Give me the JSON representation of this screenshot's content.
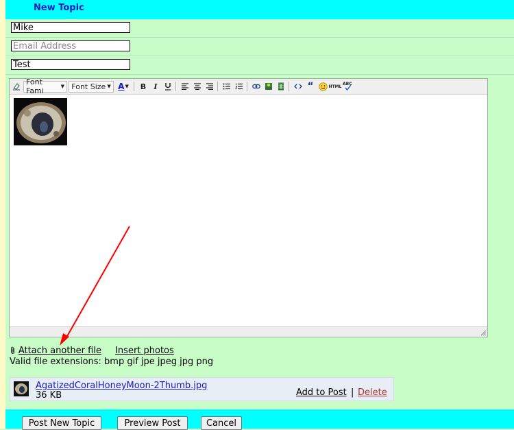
{
  "header": {
    "title": "New Topic"
  },
  "form": {
    "name_value": "Mike",
    "email_placeholder": "Email Address",
    "subject_value": "Test"
  },
  "toolbar": {
    "font_family": "Font Fami",
    "font_size": "Font Size",
    "font_color_label": "A",
    "bold": "B",
    "italic": "I",
    "html_label": "HTML",
    "spell_label": "ABC"
  },
  "attachments": {
    "attach_link": "Attach another file",
    "insert_photos": "Insert photos",
    "valid_extensions": "Valid file extensions: bmp gif jpe jpeg jpg png",
    "file_name": "AgatizedCoralHoneyMoon-2Thumb.jpg",
    "file_size": "36 KB",
    "add_to_post": "Add to Post",
    "separator": "|",
    "delete": "Delete"
  },
  "footer": {
    "post_new_topic": "Post New Topic",
    "preview_post": "Preview Post",
    "cancel": "Cancel"
  },
  "colors": {
    "header_bg": "#00ffff",
    "form_bg": "#c8fdc8",
    "title_color": "#1a1ac8",
    "delete_color": "#b03030",
    "annotation_arrow": "#ff0000"
  }
}
